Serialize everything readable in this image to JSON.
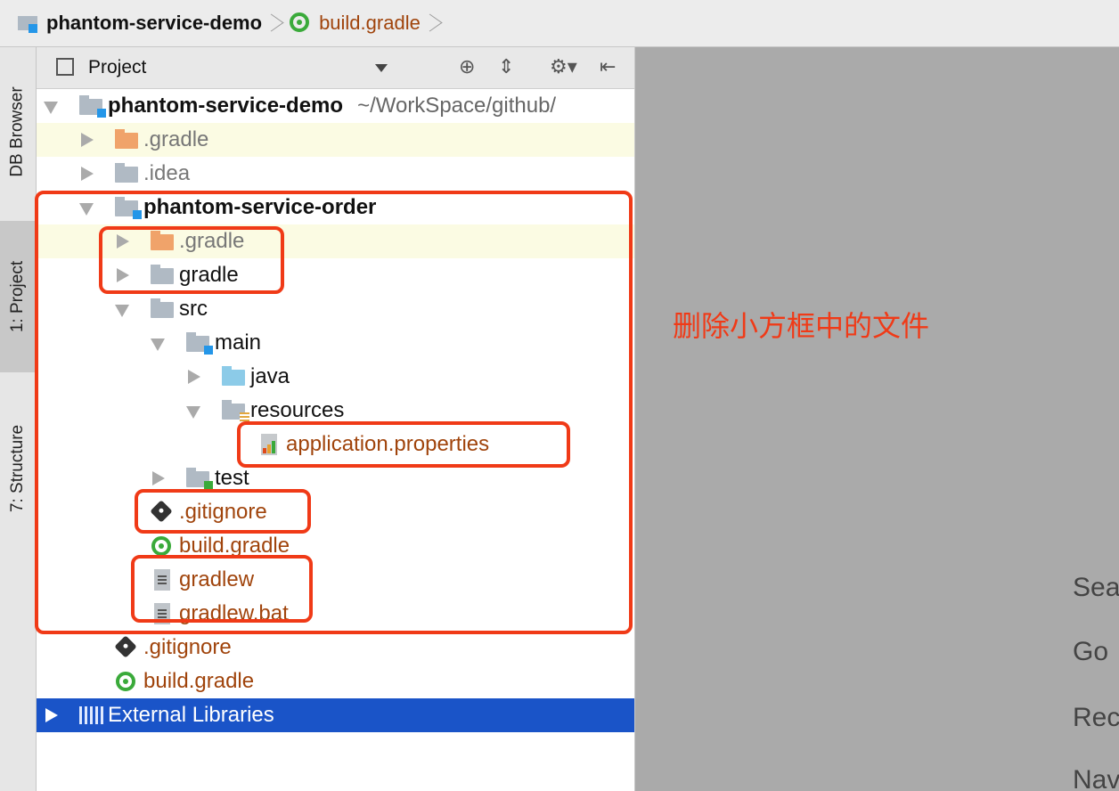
{
  "breadcrumb": {
    "project": "phantom-service-demo",
    "file": "build.gradle"
  },
  "tool_strip": {
    "db_browser": "DB Browser",
    "project": "1: Project",
    "structure": "7: Structure"
  },
  "panel": {
    "title": "Project",
    "icons": [
      "target-icon",
      "collapse-all-icon",
      "gear-icon",
      "hide-panel-icon"
    ]
  },
  "tree": {
    "root": {
      "name": "phantom-service-demo",
      "path": "~/WorkSpace/github/"
    },
    "items": [
      {
        "label": ".gradle"
      },
      {
        "label": ".idea"
      },
      {
        "label": "phantom-service-order"
      },
      {
        "label": ".gradle"
      },
      {
        "label": "gradle"
      },
      {
        "label": "src"
      },
      {
        "label": "main"
      },
      {
        "label": "java"
      },
      {
        "label": "resources"
      },
      {
        "label": "application.properties"
      },
      {
        "label": "test"
      },
      {
        "label": ".gitignore"
      },
      {
        "label": "build.gradle"
      },
      {
        "label": "gradlew"
      },
      {
        "label": "gradlew.bat"
      },
      {
        "label": ".gitignore"
      },
      {
        "label": "build.gradle"
      },
      {
        "label": "External Libraries"
      }
    ]
  },
  "annotation": {
    "note": "删除小方框中的文件",
    "color": "#f03a17"
  },
  "editor_hints": [
    "Sea",
    "Go",
    "Rec",
    "Nav"
  ],
  "colors": {
    "selection": "#1a54c8",
    "editor_bg": "#aaaaaa",
    "annotation": "#f03a17"
  }
}
